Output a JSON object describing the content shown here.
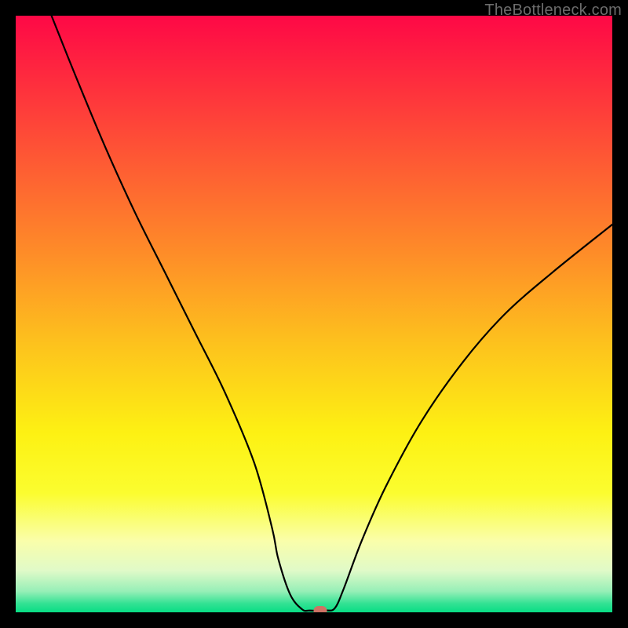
{
  "attribution": "TheBottleneck.com",
  "colors": {
    "background": "#000000",
    "attribution_text": "#6c6c6c",
    "curve": "#000000",
    "marker": "#ce7264",
    "gradient_stops": [
      {
        "pos": 0.0,
        "color": "#fe0846"
      },
      {
        "pos": 0.2,
        "color": "#fe4b37"
      },
      {
        "pos": 0.4,
        "color": "#fe8d28"
      },
      {
        "pos": 0.55,
        "color": "#fdc21d"
      },
      {
        "pos": 0.7,
        "color": "#fdf113"
      },
      {
        "pos": 0.8,
        "color": "#fbfd2f"
      },
      {
        "pos": 0.88,
        "color": "#fafeaa"
      },
      {
        "pos": 0.93,
        "color": "#e0fac8"
      },
      {
        "pos": 0.965,
        "color": "#96efb7"
      },
      {
        "pos": 0.985,
        "color": "#34e294"
      },
      {
        "pos": 1.0,
        "color": "#08dd84"
      }
    ]
  },
  "chart_data": {
    "type": "line",
    "title": "",
    "xlabel": "",
    "ylabel": "",
    "xlim": [
      0,
      100
    ],
    "ylim": [
      0,
      100
    ],
    "grid": false,
    "legend": false,
    "note": "V-shaped bottleneck curve. x is normalized position (0=left,100=right). y is normalized height (0=bottom green band, 100=top). Values estimated from pixels.",
    "series": [
      {
        "name": "bottleneck-curve",
        "x": [
          6,
          10,
          15,
          20,
          25,
          30,
          35,
          40,
          43,
          44,
          46,
          48,
          49.3,
          52,
          53.5,
          55,
          58,
          62,
          68,
          75,
          82,
          90,
          100
        ],
        "y": [
          100,
          90,
          78,
          67,
          57,
          47,
          37,
          25,
          14,
          9,
          3,
          0.5,
          0.3,
          0.3,
          0.7,
          4,
          12,
          21,
          32,
          42,
          50,
          57,
          65
        ]
      }
    ],
    "marker": {
      "x": 51,
      "y": 0.3
    }
  }
}
